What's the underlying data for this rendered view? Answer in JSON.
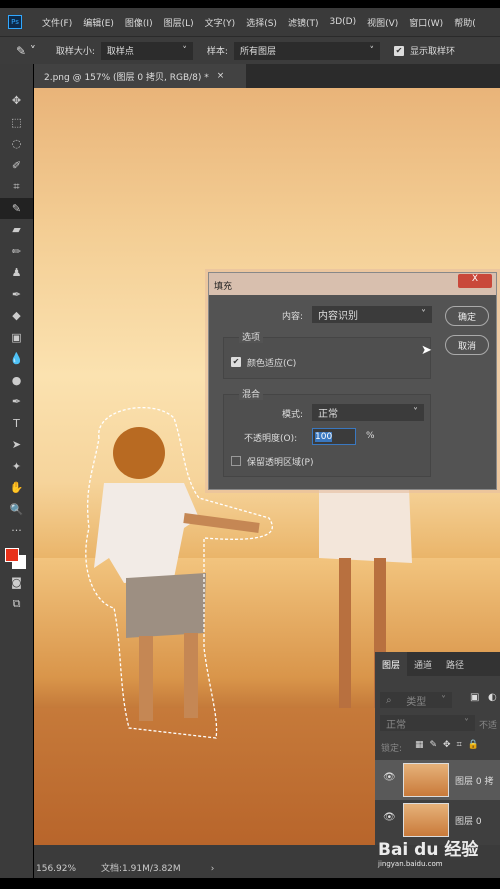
{
  "menu": {
    "items": [
      "文件(F)",
      "编辑(E)",
      "图像(I)",
      "图层(L)",
      "文字(Y)",
      "选择(S)",
      "滤镜(T)",
      "3D(D)",
      "视图(V)",
      "窗口(W)",
      "帮助("
    ]
  },
  "options": {
    "sample_size_label": "取样大小:",
    "sample_size_value": "取样点",
    "sample_label": "样本:",
    "sample_value": "所有图层",
    "show_ring_label": "显示取样环",
    "show_ring_checked": true
  },
  "document_tab": {
    "title": "2.png @ 157% (图层 0 拷贝, RGB/8) *",
    "close": "×"
  },
  "colors": {
    "foreground": "#e8321a",
    "background": "#ffffff"
  },
  "dialog": {
    "title": "填充",
    "close": "X",
    "content_label": "内容:",
    "content_value": "内容识别",
    "ok": "确定",
    "cancel": "取消",
    "options_group": "选项",
    "color_adapt": "颜色适应(C)",
    "color_adapt_checked": true,
    "blend_group": "混合",
    "mode_label": "模式:",
    "mode_value": "正常",
    "opacity_label": "不透明度(O):",
    "opacity_value": "100",
    "opacity_unit": "%",
    "preserve": "保留透明区域(P)",
    "preserve_checked": false
  },
  "layers": {
    "tabs": [
      "图层",
      "通道",
      "路径"
    ],
    "filter_placeholder": "类型",
    "blend_mode": "正常",
    "opacity_label": "不适",
    "lock_label": "锁定:",
    "items": [
      {
        "name": "图层 0 拷",
        "visible": true,
        "selected": true
      },
      {
        "name": "图层 0",
        "visible": true,
        "selected": false
      }
    ]
  },
  "status": {
    "zoom": "156.92%",
    "doc": "文档:1.91M/3.82M"
  },
  "watermark": {
    "text": "Bai du 经验",
    "url": "jingyan.baidu.com"
  }
}
